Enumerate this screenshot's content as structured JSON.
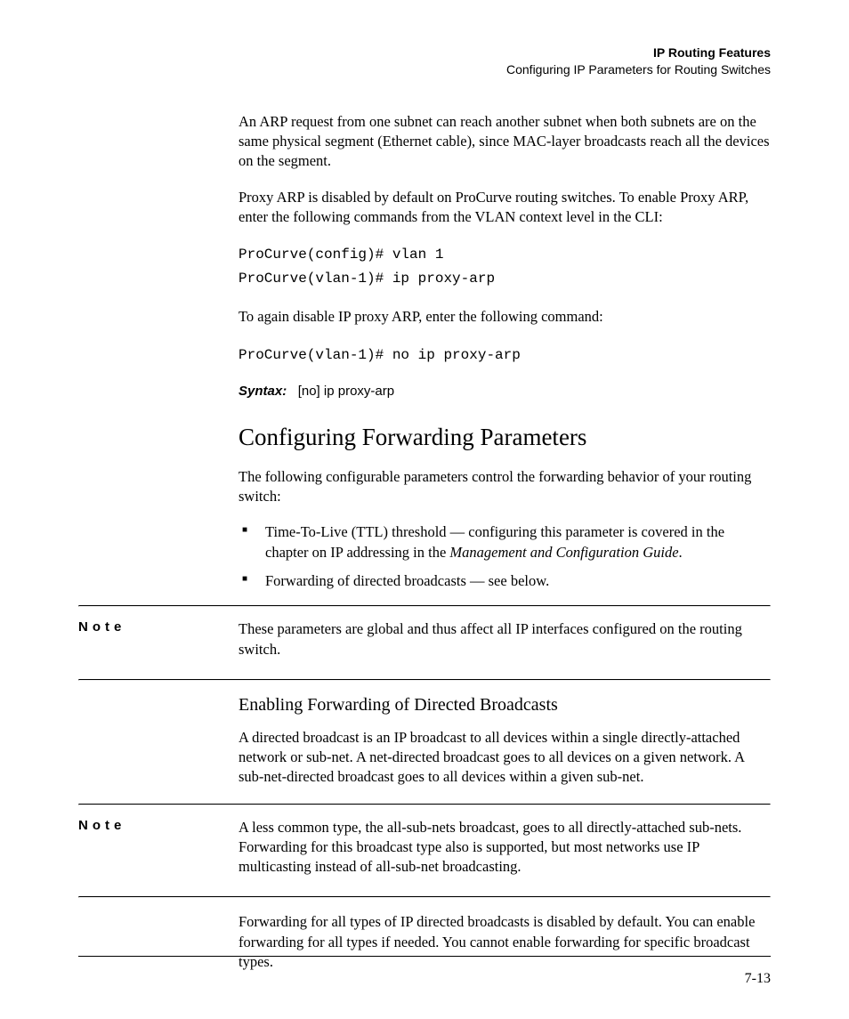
{
  "header": {
    "title": "IP Routing Features",
    "subtitle": "Configuring IP Parameters for Routing Switches"
  },
  "paragraphs": {
    "p1": "An ARP request from one subnet can reach another subnet when both subnets are on the same physical segment (Ethernet cable), since MAC-layer broadcasts reach all the devices on the segment.",
    "p2": "Proxy ARP is disabled by default on ProCurve routing switches. To enable Proxy ARP, enter the following commands from the VLAN context level in the CLI:",
    "p3": "To again disable IP proxy ARP, enter the following command:",
    "p4": "The following configurable parameters control the forwarding behavior of your routing switch:",
    "p5": "A directed broadcast is an IP broadcast to all devices within a single directly-attached network or sub-net. A net-directed broadcast goes to all devices on a given network. A sub-net-directed broadcast goes to all devices within a given sub-net.",
    "p6": "Forwarding for all types of IP directed broadcasts is disabled by default. You can enable forwarding for all types if needed. You cannot enable forwarding for specific broadcast types."
  },
  "code": {
    "c1": "ProCurve(config)# vlan 1\nProCurve(vlan-1)# ip proxy-arp",
    "c2": "ProCurve(vlan-1)# no ip proxy-arp"
  },
  "syntax": {
    "label": "Syntax:",
    "text": "[no] ip proxy-arp"
  },
  "headings": {
    "h2": "Configuring Forwarding Parameters",
    "h3": "Enabling Forwarding of Directed Broadcasts"
  },
  "bullets": {
    "b1a": "Time-To-Live (TTL) threshold — configuring this parameter is covered in the chapter on IP addressing in the ",
    "b1b": "Management and Configuration Guide",
    "b1c": ".",
    "b2": "Forwarding of directed broadcasts — see below."
  },
  "notes": {
    "label": "Note",
    "n1": "These parameters are global and thus affect all IP interfaces configured on the routing switch.",
    "n2": "A less common type, the all-sub-nets broadcast, goes to all directly-attached sub-nets. Forwarding for this broadcast type also is supported, but most networks use IP multicasting instead of all-sub-net broadcasting."
  },
  "page_number": "7-13"
}
